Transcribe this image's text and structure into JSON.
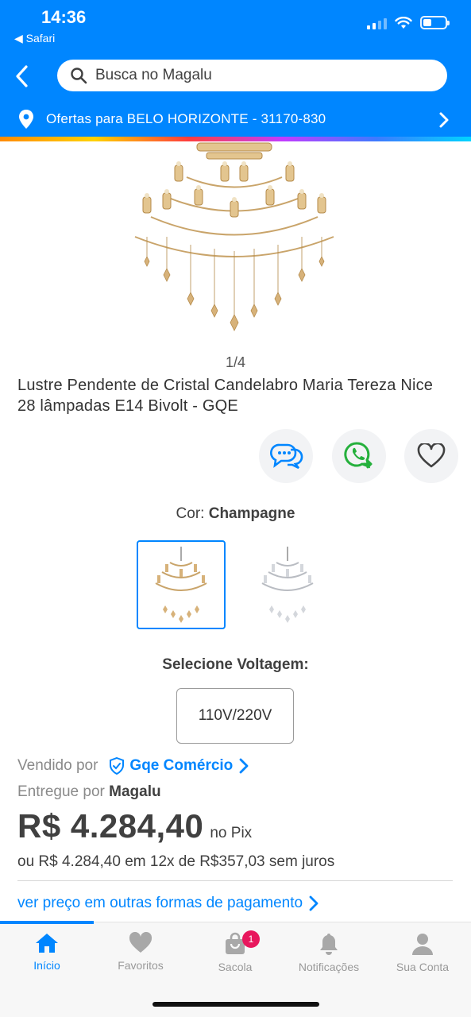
{
  "status": {
    "time": "14:36",
    "back_app": "◀ Safari"
  },
  "header": {
    "search_placeholder": "Busca no Magalu",
    "location": "Ofertas para BELO HORIZONTE - 31170-830"
  },
  "product": {
    "pager": "1/4",
    "title": "Lustre Pendente de Cristal Candelabro Maria Tereza Nice 28 lâmpadas E14 Bivolt - GQE",
    "color_prefix": "Cor:",
    "color_value": "Champagne",
    "voltage_label": "Selecione Voltagem:",
    "voltage_option": "110V/220V",
    "sold_by_prefix": "Vendido por",
    "seller": "Gqe Comércio",
    "delivered_prefix": "Entregue por",
    "delivered_by": "Magalu",
    "price": "R$ 4.284,40",
    "price_suffix": "no Pix",
    "installments": "ou R$ 4.284,40 em 12x de R$357,03 sem juros",
    "payment_link": "ver preço em outras formas de pagamento"
  },
  "nav": {
    "items": [
      {
        "label": "Início",
        "icon": "home-icon"
      },
      {
        "label": "Favoritos",
        "icon": "heart-icon"
      },
      {
        "label": "Sacola",
        "icon": "bag-icon",
        "badge": "1"
      },
      {
        "label": "Notificações",
        "icon": "bell-icon"
      },
      {
        "label": "Sua Conta",
        "icon": "user-icon"
      }
    ]
  },
  "colors": {
    "brand": "#0086ff",
    "badge": "#e8175d",
    "whatsapp": "#25b03c"
  }
}
